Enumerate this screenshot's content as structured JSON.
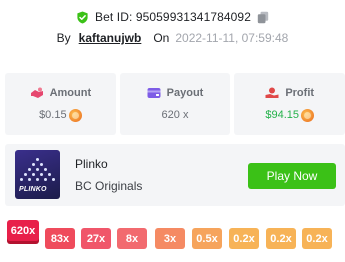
{
  "header": {
    "bet_id": "Bet ID: 95059931341784092",
    "by_label": "By",
    "username": "kaftanujwb",
    "on_label": "On",
    "datetime": "2022-11-11, 07:59:48"
  },
  "stats": {
    "amount": {
      "label": "Amount",
      "value": "$0.15",
      "icon": "bet-hand-icon"
    },
    "payout": {
      "label": "Payout",
      "value": "620 x",
      "icon": "wallet-icon"
    },
    "profit": {
      "label": "Profit",
      "value": "$94.15",
      "icon": "profit-icon",
      "value_color": "#24b14a"
    }
  },
  "game": {
    "title": "Plinko",
    "provider": "BC Originals",
    "thumb_label": "PLINKO",
    "play_label": "Play Now",
    "play_color": "#3bc117"
  },
  "multipliers": [
    {
      "label": "620x",
      "color": "#e8204a",
      "active": true
    },
    {
      "label": "83x",
      "color": "#ef4b5c"
    },
    {
      "label": "27x",
      "color": "#f0566a"
    },
    {
      "label": "8x",
      "color": "#f26a6f"
    },
    {
      "label": "3x",
      "color": "#f58a63"
    },
    {
      "label": "0.5x",
      "color": "#f6a45c"
    },
    {
      "label": "0.2x",
      "color": "#f7b357"
    },
    {
      "label": "0.2x",
      "color": "#f7b357"
    },
    {
      "label": "0.2x",
      "color": "#f7b357"
    }
  ]
}
